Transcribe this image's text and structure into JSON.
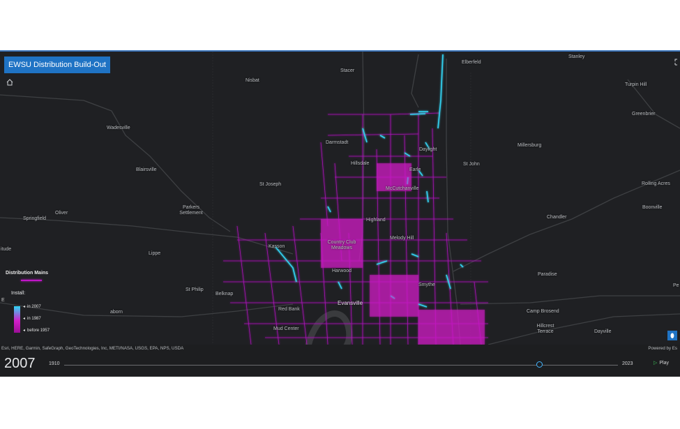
{
  "app": {
    "title": "EWSU Distribution Build-Out"
  },
  "map": {
    "places": [
      {
        "label": "Stanley"
      },
      {
        "label": "Elberfeld"
      },
      {
        "label": "Stacer"
      },
      {
        "label": "Nisbat"
      },
      {
        "label": "Turpin Hill"
      },
      {
        "label": "Greenbrier"
      },
      {
        "label": "Wadesville"
      },
      {
        "label": "Darmstadt"
      },
      {
        "label": "Daylight"
      },
      {
        "label": "Millersburg"
      },
      {
        "label": "Hillsdale"
      },
      {
        "label": "St John"
      },
      {
        "label": "Earle"
      },
      {
        "label": "Blairsville"
      },
      {
        "label": "St Joseph"
      },
      {
        "label": "McCutchanville"
      },
      {
        "label": "Rolling Acres"
      },
      {
        "label": "Parkers\nSettlement"
      },
      {
        "label": "Boonville"
      },
      {
        "label": "Oliver"
      },
      {
        "label": "Springfield"
      },
      {
        "label": "Chandler"
      },
      {
        "label": "Highland"
      },
      {
        "label": "Melody Hill"
      },
      {
        "label": "Country Club\nMeadows"
      },
      {
        "label": "Kasson"
      },
      {
        "label": "itude"
      },
      {
        "label": "Lippe"
      },
      {
        "label": "Harwood"
      },
      {
        "label": "Paradise"
      },
      {
        "label": "Smythe"
      },
      {
        "label": "St Philip"
      },
      {
        "label": "Belknap"
      },
      {
        "label": "Evansville"
      },
      {
        "label": "Red Bank"
      },
      {
        "label": "aborn"
      },
      {
        "label": "Camp Brosend"
      },
      {
        "label": "Hillcrest\nTerrace"
      },
      {
        "label": "Dayville"
      },
      {
        "label": "Mud Center"
      },
      {
        "label": "Pe"
      }
    ],
    "edge_label": "E",
    "attribution": "Esri, HERE, Garmin, SafeGraph, GeoTechnologies, Inc, METI/NASA, USGS, EPA, NPS, USDA",
    "powered_by": "Powered by Es"
  },
  "legend": {
    "title": "Distribution Mains",
    "install_label": "Install:",
    "stops": [
      "in 2007",
      "in 1987",
      "before 1957"
    ],
    "colors": {
      "recent": "#2fd7f4",
      "mid": "#d21ec8",
      "old": "#9a0f96"
    }
  },
  "time_slider": {
    "current_year": "2007",
    "min": "1910",
    "max": "2023",
    "current_value": 2007,
    "min_value": 1910,
    "max_value": 2023,
    "play_label": "Play"
  },
  "icons": {
    "home": "home-icon",
    "fullscreen": "fullscreen-icon",
    "locate": "locate-icon",
    "play": "play-icon"
  }
}
